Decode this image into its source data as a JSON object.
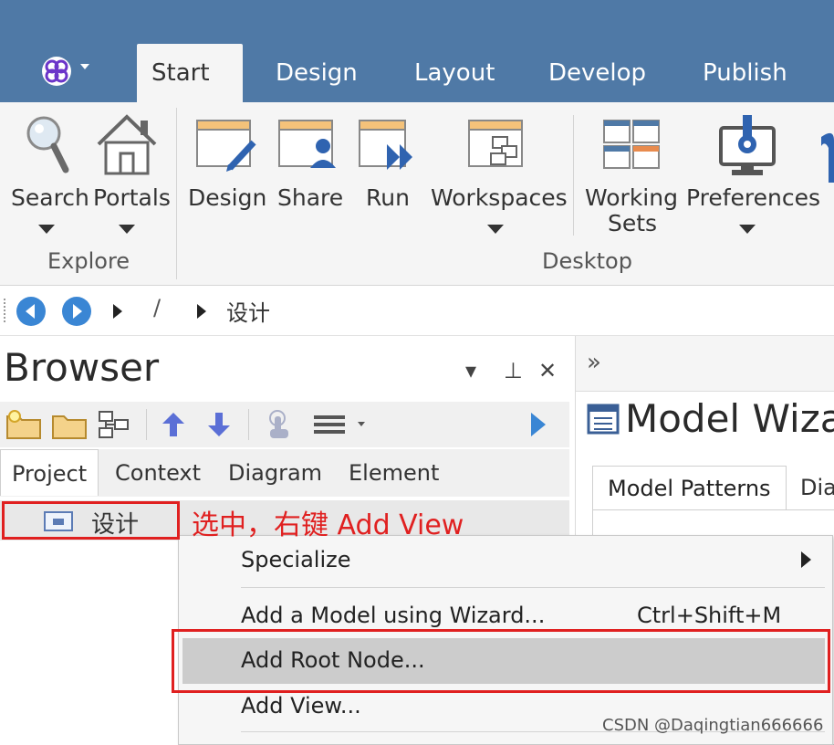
{
  "ribbon_tabs": [
    {
      "label": "Start",
      "active": true
    },
    {
      "label": "Design",
      "active": false
    },
    {
      "label": "Layout",
      "active": false
    },
    {
      "label": "Develop",
      "active": false
    },
    {
      "label": "Publish",
      "active": false
    }
  ],
  "ribbon": {
    "explore": {
      "group_label": "Explore",
      "buttons": [
        {
          "label": "Search",
          "icon": "search-icon",
          "has_dropdown": true
        },
        {
          "label": "Portals",
          "icon": "home-icon",
          "has_dropdown": true
        }
      ]
    },
    "desktop": {
      "group_label": "Desktop",
      "buttons": [
        {
          "label": "Design",
          "icon": "design-window-icon",
          "has_dropdown": false
        },
        {
          "label": "Share",
          "icon": "share-window-icon",
          "has_dropdown": false
        },
        {
          "label": "Run",
          "icon": "run-window-icon",
          "has_dropdown": false
        },
        {
          "label": "Workspaces",
          "icon": "workspaces-icon",
          "has_dropdown": true
        },
        {
          "label": "Working",
          "label2": "Sets",
          "icon": "working-sets-icon",
          "has_dropdown": false
        },
        {
          "label": "Preferences",
          "icon": "preferences-icon",
          "has_dropdown": true
        }
      ]
    }
  },
  "navbar": {
    "separator": "/",
    "path": "设计"
  },
  "browser": {
    "title": "Browser",
    "controls": {
      "dropdown": "▾",
      "pin": "⊥",
      "close": "✕"
    },
    "tabs": [
      {
        "label": "Project",
        "active": true
      },
      {
        "label": "Context",
        "active": false
      },
      {
        "label": "Diagram",
        "active": false
      },
      {
        "label": "Element",
        "active": false
      }
    ],
    "tree": [
      {
        "label": "设计",
        "icon": "package-icon",
        "selected": true
      }
    ]
  },
  "right_panel": {
    "collapse_glyph": "»",
    "title": "Model Wiza",
    "tabs": [
      {
        "label": "Model Patterns",
        "active": true
      },
      {
        "label": "Dia",
        "active": false
      }
    ]
  },
  "context_menu": {
    "items": [
      {
        "label": "Specialize",
        "shortcut": "",
        "has_submenu": true,
        "highlighted": false
      },
      {
        "label": "Add a Model using Wizard...",
        "shortcut": "Ctrl+Shift+M",
        "has_submenu": false,
        "highlighted": false
      },
      {
        "label": "Add Root Node...",
        "shortcut": "",
        "has_submenu": false,
        "highlighted": true
      },
      {
        "label": "Add View...",
        "shortcut": "",
        "has_submenu": false,
        "highlighted": false
      }
    ]
  },
  "annotation": {
    "text": "选中，右键 Add View",
    "color": "#e02020"
  },
  "watermark": "CSDN @Daqingtian666666",
  "colors": {
    "title_bar": "#4f79a6",
    "ribbon_bg": "#f5f5f5",
    "accent_blue": "#3a86d4",
    "annotation_red": "#e02020",
    "menu_highlight": "#cccccc"
  }
}
